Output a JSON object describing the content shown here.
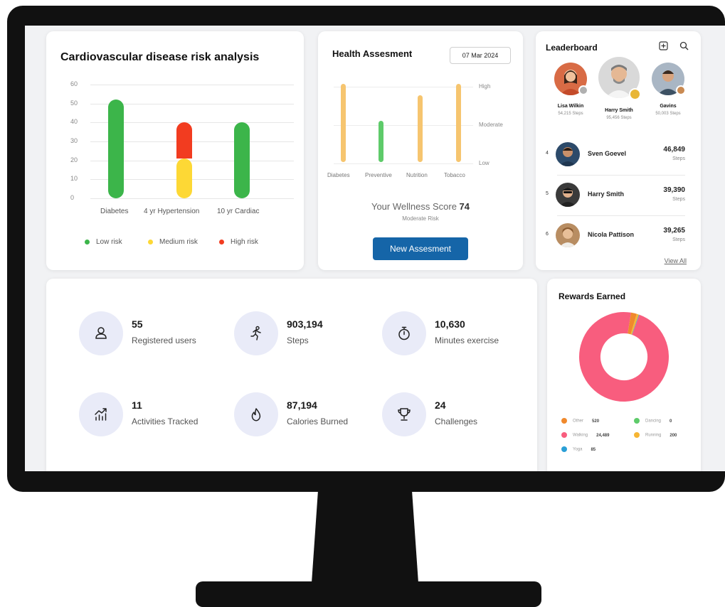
{
  "colors": {
    "low_risk": "#3cb54a",
    "medium_risk": "#fdd835",
    "high_risk": "#f23c20",
    "health_bar": "#f6c56f",
    "health_bar_good": "#5ecb6a",
    "primary_button": "#1565a8",
    "donut_walking": "#f85d7e",
    "donut_running": "#f6b533",
    "donut_other": "#f0892c",
    "donut_yoga": "#2a9fd6",
    "donut_dancing": "#5ecb6a"
  },
  "cardio": {
    "title": "Cardiovascular disease risk analysis",
    "legend": [
      "Low risk",
      "Medium risk",
      "High risk"
    ]
  },
  "chart_data": [
    {
      "type": "bar",
      "title": "Cardiovascular disease risk analysis",
      "categories": [
        "Diabetes",
        "4 yr Hypertension",
        "10 yr Cardiac"
      ],
      "ylim": [
        0,
        60
      ],
      "yticks": [
        60,
        50,
        40,
        30,
        20,
        10,
        0
      ],
      "stacked": true,
      "series": [
        {
          "name": "Low risk",
          "values": [
            52,
            0,
            40
          ]
        },
        {
          "name": "Medium risk",
          "values": [
            0,
            21,
            0
          ]
        },
        {
          "name": "High risk",
          "values": [
            0,
            19,
            0
          ]
        }
      ],
      "legend": "bottom",
      "grid": true
    },
    {
      "type": "bar",
      "title": "Health Assesment",
      "categories": [
        "Diabetes",
        "Preventive",
        "Nutrition",
        "Tobacco"
      ],
      "levels": [
        "High",
        "Moderate",
        "Low"
      ],
      "values": [
        "High",
        "Moderate-Low",
        "High-Moderate",
        "High"
      ]
    },
    {
      "type": "pie",
      "title": "Rewards Earned",
      "donut": true,
      "labels": [
        "Other",
        "Walking",
        "Yoga",
        "Dancing",
        "Running"
      ],
      "values": [
        520,
        24489,
        85,
        0,
        200
      ]
    }
  ],
  "health": {
    "title": "Health Assesment",
    "date": "07 Mar 2024",
    "levels": [
      "High",
      "Moderate",
      "Low"
    ],
    "categories": [
      "Diabetes",
      "Preventive",
      "Nutrition",
      "Tobacco"
    ],
    "score_label": "Your Wellness Score",
    "score_value": "74",
    "score_sub": "Moderate Risk",
    "button": "New Assesment"
  },
  "leaderboard": {
    "title": "Leaderboard",
    "podium": [
      {
        "name": "Lisa Wilkin",
        "steps": "54,215 Steps"
      },
      {
        "name": "Harry Smith",
        "steps": "95,456 Steps"
      },
      {
        "name": "Gavins",
        "steps": "50,003 Steps"
      }
    ],
    "rows": [
      {
        "rank": "4",
        "name": "Sven Goevel",
        "steps": "46,849",
        "unit": "Steps"
      },
      {
        "rank": "5",
        "name": "Harry Smith",
        "steps": "39,390",
        "unit": "Steps"
      },
      {
        "rank": "6",
        "name": "Nicola Pattison",
        "steps": "39,265",
        "unit": "Steps"
      }
    ],
    "view_all": "View All"
  },
  "stats": [
    {
      "value": "55",
      "label": "Registered users",
      "icon": "user-icon"
    },
    {
      "value": "903,194",
      "label": "Steps",
      "icon": "running-icon"
    },
    {
      "value": "10,630",
      "label": "Minutes exercise",
      "icon": "stopwatch-icon"
    },
    {
      "value": "11",
      "label": "Activities Tracked",
      "icon": "trend-chart-icon"
    },
    {
      "value": "87,194",
      "label": "Calories Burned",
      "icon": "flame-icon"
    },
    {
      "value": "24",
      "label": "Challenges",
      "icon": "trophy-icon"
    }
  ],
  "rewards": {
    "title": "Rewards Earned",
    "legend": [
      {
        "label": "Other",
        "value": "520"
      },
      {
        "label": "Dancing",
        "value": "0"
      },
      {
        "label": "Walking",
        "value": "24,489"
      },
      {
        "label": "Running",
        "value": "200"
      },
      {
        "label": "Yoga",
        "value": "85"
      }
    ]
  }
}
